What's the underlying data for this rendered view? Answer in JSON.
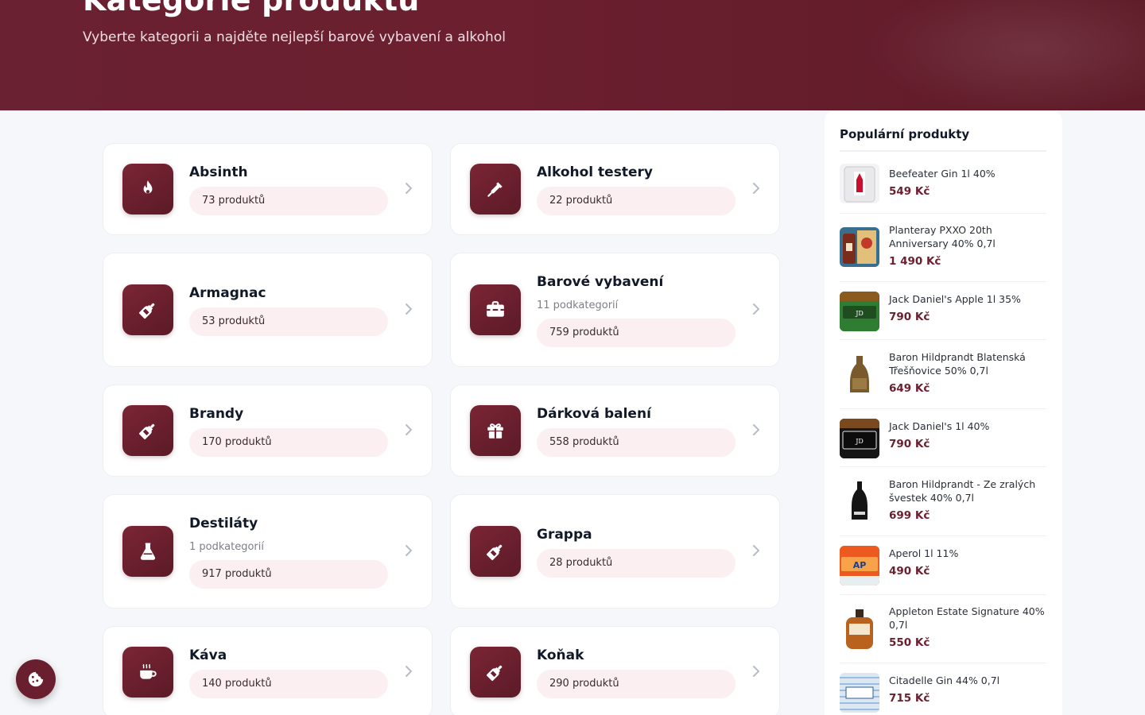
{
  "hero": {
    "title": "Kategorie produktů",
    "subtitle": "Vyberte kategorii a najděte nejlepší barové vybavení a alkohol"
  },
  "categories": [
    {
      "name": "Absinth",
      "subcategories": "",
      "count": "73 produktů",
      "icon": "flame-icon"
    },
    {
      "name": "Alkohol testery",
      "subcategories": "",
      "count": "22 produktů",
      "icon": "pipette-icon"
    },
    {
      "name": "Armagnac",
      "subcategories": "",
      "count": "53 produktů",
      "icon": "bottle-icon"
    },
    {
      "name": "Barové vybavení",
      "subcategories": "11 podkategorií",
      "count": "759 produktů",
      "icon": "toolbox-icon"
    },
    {
      "name": "Brandy",
      "subcategories": "",
      "count": "170 produktů",
      "icon": "bottle-icon"
    },
    {
      "name": "Dárková balení",
      "subcategories": "",
      "count": "558 produktů",
      "icon": "gift-icon"
    },
    {
      "name": "Destiláty",
      "subcategories": "1 podkategorií",
      "count": "917 produktů",
      "icon": "flask-icon"
    },
    {
      "name": "Grappa",
      "subcategories": "",
      "count": "28 produktů",
      "icon": "bottle-icon"
    },
    {
      "name": "Káva",
      "subcategories": "",
      "count": "140 produktů",
      "icon": "coffee-icon"
    },
    {
      "name": "Koňak",
      "subcategories": "",
      "count": "290 produktů",
      "icon": "bottle-icon"
    }
  ],
  "sidebar": {
    "title": "Populární produkty",
    "products": [
      {
        "name": "Beefeater Gin 1l 40%",
        "price": "549 Kč"
      },
      {
        "name": "Planteray PXXO 20th Anniversary 40% 0,7l",
        "price": "1 490 Kč"
      },
      {
        "name": "Jack Daniel's Apple 1l 35%",
        "price": "790 Kč"
      },
      {
        "name": "Baron Hildprandt Blatenská Třešňovice 50% 0,7l",
        "price": "649 Kč"
      },
      {
        "name": "Jack Daniel's 1l 40%",
        "price": "790 Kč"
      },
      {
        "name": "Baron Hildprandt - Ze zralých švestek 40% 0,7l",
        "price": "699 Kč"
      },
      {
        "name": "Aperol 1l 11%",
        "price": "490 Kč"
      },
      {
        "name": "Appleton Estate Signature 40% 0,7l",
        "price": "550 Kč"
      },
      {
        "name": "Citadelle Gin 44% 0,7l",
        "price": "715 Kč"
      }
    ]
  },
  "colors": {
    "brand": "#6b1f2f",
    "badge_bg": "#fbeff1",
    "page_bg": "#f6f7fa"
  },
  "cookie_button": {
    "icon": "cookie-icon"
  }
}
